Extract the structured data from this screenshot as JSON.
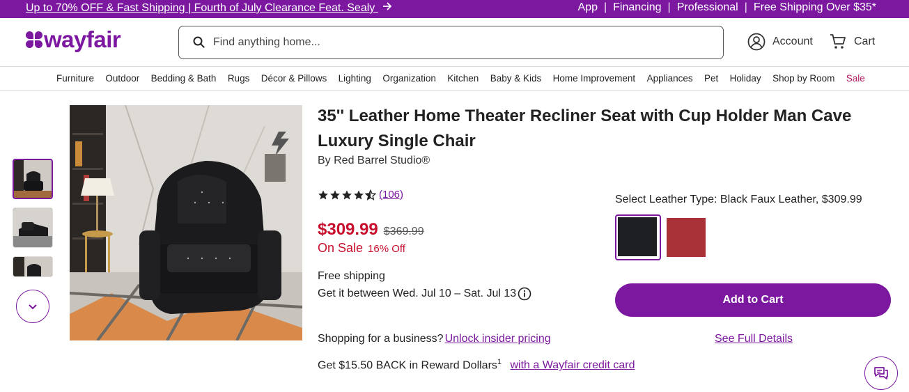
{
  "promo": {
    "left_text": "Up to 70% OFF & Fast Shipping | Fourth of July Clearance Feat. Sealy",
    "links": [
      "App",
      "Financing",
      "Professional",
      "Free Shipping Over $35*"
    ]
  },
  "header": {
    "logo_text": "wayfair",
    "search_placeholder": "Find anything home...",
    "account_label": "Account",
    "cart_label": "Cart"
  },
  "nav": {
    "items": [
      "Furniture",
      "Outdoor",
      "Bedding & Bath",
      "Rugs",
      "Décor & Pillows",
      "Lighting",
      "Organization",
      "Kitchen",
      "Baby & Kids",
      "Home Improvement",
      "Appliances",
      "Pet",
      "Holiday",
      "Shop by Room",
      "Sale"
    ]
  },
  "product": {
    "title": "35'' Leather Home Theater Recliner Seat with Cup Holder Man Cave Luxury Single Chair",
    "brand": "By Red Barrel Studio®",
    "rating": 4.5,
    "review_count": "(106)",
    "price": "$309.99",
    "was_price": "$369.99",
    "on_sale": "On Sale",
    "pct_off": "16% Off",
    "shipping": "Free shipping",
    "delivery": "Get it between Wed. Jul 10 – Sat. Jul 13",
    "business_text": "Shopping for a business?",
    "business_link": "Unlock insider pricing",
    "reward_text": "Get $15.50 BACK in Reward Dollars",
    "reward_sup": "1",
    "reward_link": "with a Wayfair credit card"
  },
  "options": {
    "label": "Select Leather Type: Black Faux Leather, $309.99",
    "swatches": [
      {
        "name": "Black Faux Leather",
        "color": "#1e1f23",
        "selected": true
      },
      {
        "name": "Red",
        "color": "#a83238",
        "selected": false
      }
    ],
    "add_to_cart": "Add to Cart",
    "see_full_details": "See Full Details"
  },
  "colors": {
    "brand": "#7b189f",
    "sale_red": "#c8102e"
  }
}
